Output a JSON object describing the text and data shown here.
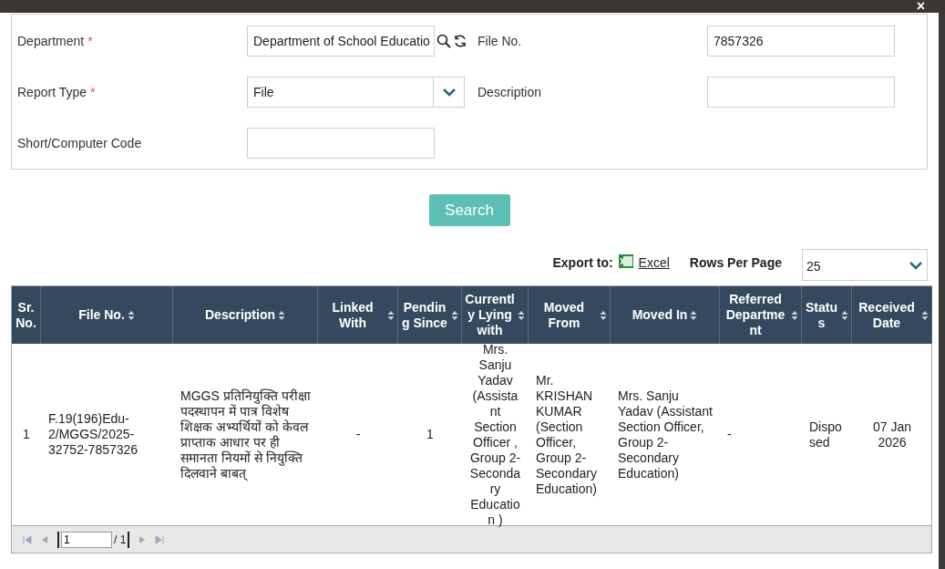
{
  "close_label": "×",
  "required_marker": "*",
  "form": {
    "fields": [
      {
        "label": "Department",
        "required": true,
        "kind": "lookup",
        "value": "Department of School Educatio"
      },
      {
        "label": "File No.",
        "required": false,
        "kind": "text",
        "value": "7857326"
      },
      {
        "label": "Report Type",
        "required": true,
        "kind": "select",
        "value": "File"
      },
      {
        "label": "Description",
        "required": false,
        "kind": "text"
      },
      {
        "label": "Short/Computer Code",
        "required": false,
        "kind": "text"
      }
    ]
  },
  "search_button": "Search",
  "export": {
    "label": "Export to:",
    "link": "Excel"
  },
  "rows_per_page": {
    "label": "Rows Per Page",
    "value": "25"
  },
  "table": {
    "columns": [
      {
        "label": "Sr. No.",
        "sortable": false
      },
      {
        "label": "File No.",
        "sortable": true
      },
      {
        "label": "Description",
        "sortable": true
      },
      {
        "label": "Linked With",
        "sortable": true
      },
      {
        "label": "Pending Since",
        "sortable": true
      },
      {
        "label": "Currently Lying with",
        "sortable": true
      },
      {
        "label": "Moved From",
        "sortable": true
      },
      {
        "label": "Moved In",
        "sortable": true
      },
      {
        "label": "Referred Department",
        "sortable": true
      },
      {
        "label": "Status",
        "sortable": true
      },
      {
        "label": "Received Date",
        "sortable": true
      }
    ],
    "rows": [
      [
        "1",
        "F.19(196)Edu-2/MGGS/2025-32752-7857326",
        "MGGS प्रतिनियुक्ति परीक्षा पदस्थापन में पात्र विशेष शिक्षक अभ्यर्थियों को केवल प्राप्ताक आधार पर ही समानता नियमों से नियुक्ति दिलवाने बाबत्",
        "-",
        "1",
        "Mrs. Sanju Yadav (Assistant Section Officer , Group 2-Secondary Education )",
        "Mr. KRISHAN KUMAR (Section Officer, Group 2-Secondary Education)",
        "Mrs. Sanju Yadav (Assistant Section Officer, Group 2-Secondary Education)",
        "-",
        "Disposed",
        "07 Jan 2026"
      ]
    ]
  },
  "pager": {
    "page": "1",
    "total": "/ 1"
  }
}
